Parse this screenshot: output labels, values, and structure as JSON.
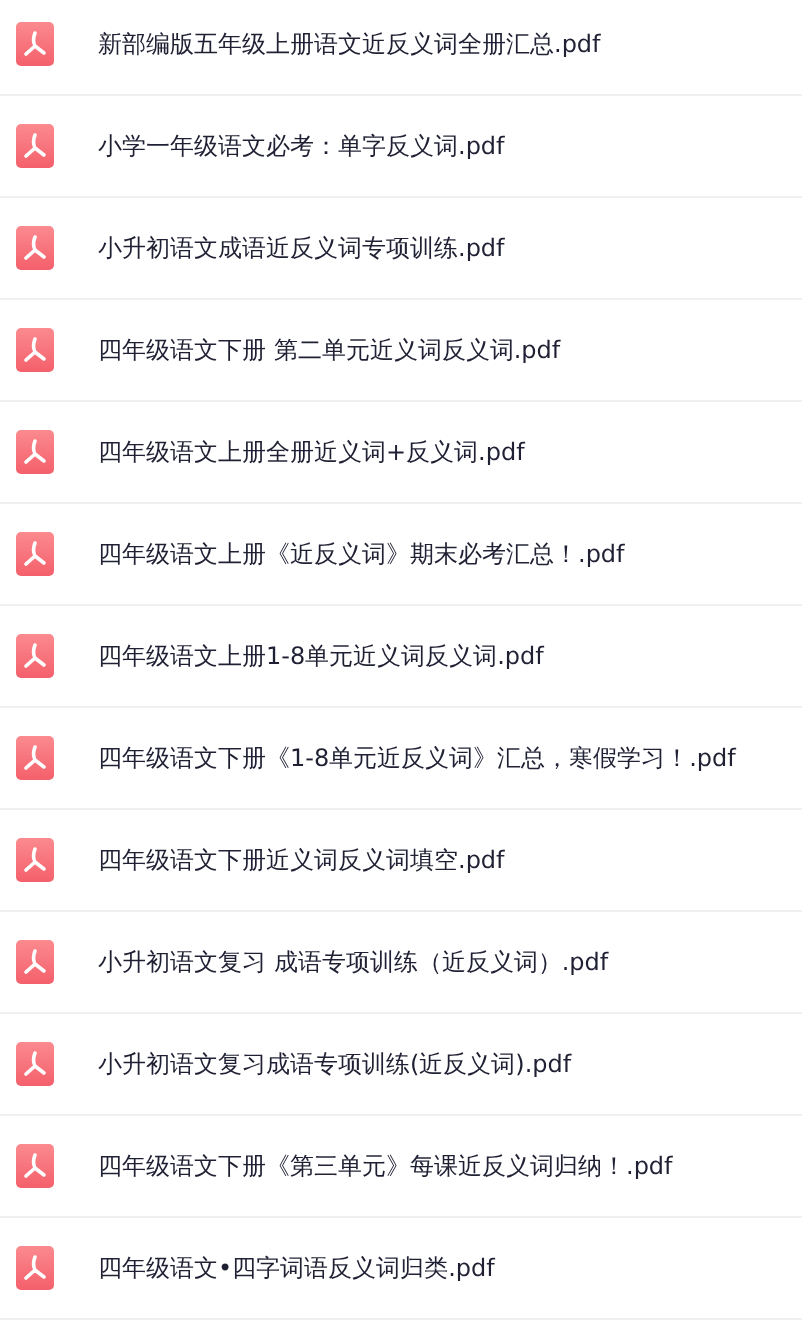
{
  "files": [
    {
      "name": "新部编版五年级上册语文近反义词全册汇总.pdf"
    },
    {
      "name": "小学一年级语文必考：单字反义词.pdf"
    },
    {
      "name": "小升初语文成语近反义词专项训练.pdf"
    },
    {
      "name": "四年级语文下册 第二单元近义词反义词.pdf"
    },
    {
      "name": "四年级语文上册全册近义词+反义词.pdf"
    },
    {
      "name": "四年级语文上册《近反义词》期末必考汇总！.pdf"
    },
    {
      "name": "四年级语文上册1-8单元近义词反义词.pdf"
    },
    {
      "name": "四年级语文下册《1-8单元近反义词》汇总，寒假学习！.pdf"
    },
    {
      "name": "四年级语文下册近义词反义词填空.pdf"
    },
    {
      "name": "小升初语文复习 成语专项训练（近反义词）.pdf"
    },
    {
      "name": "小升初语文复习成语专项训练(近反义词).pdf"
    },
    {
      "name": "四年级语文下册《第三单元》每课近反义词归纳！.pdf"
    },
    {
      "name": "四年级语文•四字词语反义词归类.pdf"
    }
  ]
}
